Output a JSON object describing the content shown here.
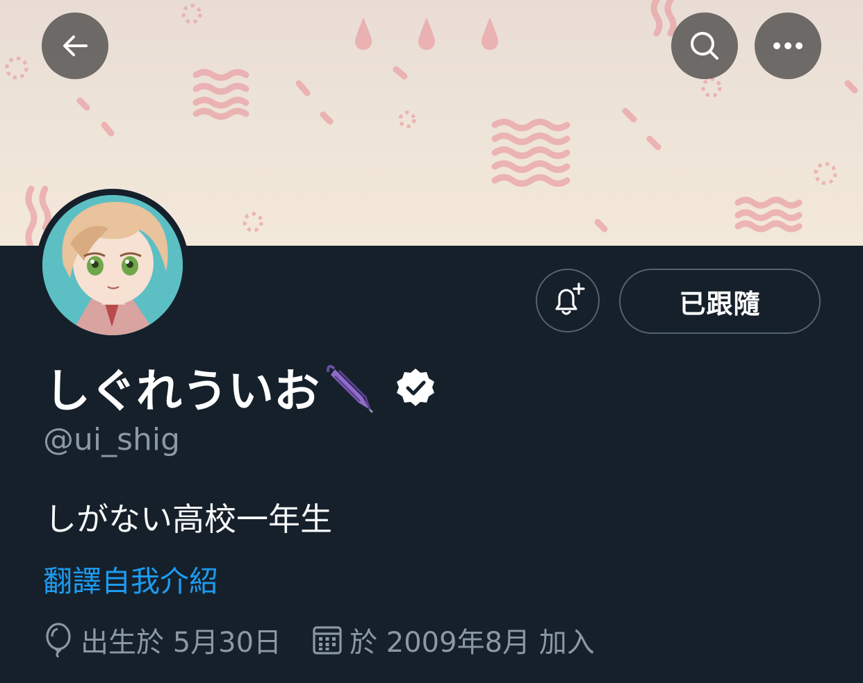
{
  "header": {
    "back_icon": "arrow-left-icon",
    "search_icon": "search-icon",
    "more_icon": "more-horizontal-icon"
  },
  "profile": {
    "display_name": "しぐれういお",
    "name_emoji": "closed-umbrella-emoji",
    "verified_icon": "verified-badge-icon",
    "handle": "@ui_shig",
    "bio": "しがない高校一年生",
    "translate_bio": "翻譯自我介紹",
    "birthday": "出生於 5月30日",
    "joined": "於 2009年8月 加入"
  },
  "actions": {
    "notify_icon": "bell-plus-icon",
    "following_label": "已跟隨"
  },
  "colors": {
    "background": "#15202b",
    "accent": "#1d9bf0",
    "secondary_text": "#8b98a5",
    "banner_pattern": "#e8a5a8"
  }
}
